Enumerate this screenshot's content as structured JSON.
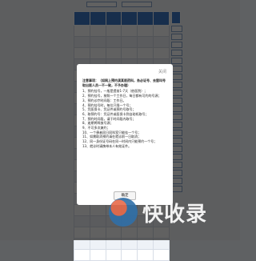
{
  "background": {
    "select_left": "",
    "select_right": "",
    "group_labels": [
      "",
      ""
    ],
    "footer_note": ""
  },
  "modal": {
    "close_label": "关闭",
    "heading": "注意事项：（如网上预约演某医药科，务必证号、去窗叫号取出医人员一不一致，不予办理）",
    "items": [
      "1、预约挂号，一般是提前1-7天（依医院）；",
      "2、预约挂号，按照一个工作日，每日都有可约的号源；",
      "3、预约诊疗时间段：工作日。",
      "4、预约挂号时，每位只限一个号；",
      "5、凭医保卡、凭证件或预约号取号；",
      "6、取预约号：凭证件或医保卡到自助机取号；",
      "7、预约时间段，请于时间段内取号；",
      "8、逾期将释放号源；",
      "9、不可多次爽约；",
      "10、一个患者同日同科室只能挂一个号；",
      "11、如需取消预约请在就诊前一日取消；",
      "12、同一身份证号码在同一时间内只能预约一个号；",
      "13、就诊时请携带本人有效证件。"
    ],
    "ok_label": "确定"
  },
  "watermark": {
    "text": "快收录"
  }
}
